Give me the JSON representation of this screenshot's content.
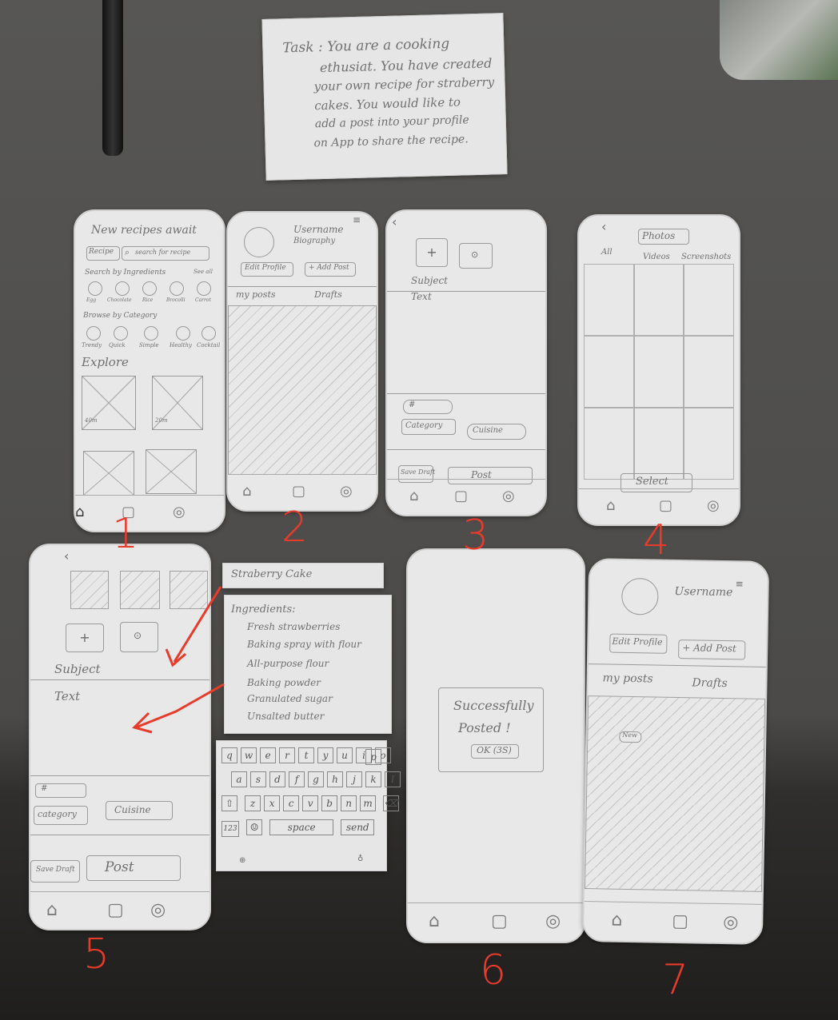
{
  "task_card": {
    "lines": [
      "Task : You are a cooking",
      "ethusiat. You have created",
      "your own recipe for straberry",
      "cakes. You would like to",
      "add a post into your profile",
      "on App to share the recipe."
    ]
  },
  "screen1": {
    "title": "New recipes await",
    "recipe_dropdown": "Recipe",
    "search_placeholder": "search for recipe",
    "search_by_label": "Search by Ingredients",
    "see_all": "See all",
    "ingredients": [
      "Egg",
      "Chocolate",
      "Rice",
      "Brocolli",
      "Carrot"
    ],
    "browse_label": "Browse by Category",
    "categories": [
      "Trendy",
      "Quick",
      "Simple",
      "Healthy",
      "Cocktail"
    ],
    "explore": "Explore",
    "card_times": [
      "40m",
      "20m"
    ]
  },
  "screen2": {
    "username": "Username",
    "biography": "Biography",
    "edit_profile": "Edit Profile",
    "add_post": "+ Add Post",
    "tab_posts": "my posts",
    "tab_drafts": "Drafts"
  },
  "screen3": {
    "subject": "Subject",
    "text": "Text",
    "hashtag": "#",
    "category": "Category",
    "cuisine": "Cuisine",
    "save_draft": "Save Draft",
    "post": "Post"
  },
  "screen4": {
    "title": "Photos",
    "tabs": [
      "All",
      "Videos",
      "Screenshots"
    ],
    "select": "Select"
  },
  "screen5": {
    "subject": "Subject",
    "text": "Text",
    "hashtag": "#",
    "category": "category",
    "cuisine": "Cuisine",
    "save_draft": "Save Draft",
    "post": "Post"
  },
  "strip_title": "Straberry Cake",
  "ingredients_note": {
    "heading": "Ingredients:",
    "items": [
      "Fresh strawberries",
      "Baking spray with flour",
      "All-purpose flour",
      "Baking powder",
      "Granulated sugar",
      "Unsalted butter"
    ]
  },
  "keyboard": {
    "row1": [
      "q",
      "w",
      "e",
      "r",
      "t",
      "y",
      "u",
      "i",
      "o",
      "p"
    ],
    "row2": [
      "a",
      "s",
      "d",
      "f",
      "g",
      "h",
      "j",
      "k",
      "l"
    ],
    "row3": [
      "z",
      "x",
      "c",
      "v",
      "b",
      "n",
      "m"
    ],
    "num_key": "123",
    "space": "space",
    "send": "send"
  },
  "screen6": {
    "dialog_line1": "Successfully",
    "dialog_line2": "Posted !",
    "ok_button": "OK (3S)"
  },
  "screen7": {
    "username": "Username",
    "edit_profile": "Edit Profile",
    "add_post": "+ Add Post",
    "tab_posts": "my posts",
    "tab_drafts": "Drafts",
    "new_badge": "New"
  },
  "screen_numbers": [
    "1",
    "2",
    "3",
    "4",
    "5",
    "6",
    "7"
  ],
  "colors": {
    "annotation_red": "#e83b2a",
    "paper": "#e8e8e8",
    "table": "#504f4d"
  }
}
